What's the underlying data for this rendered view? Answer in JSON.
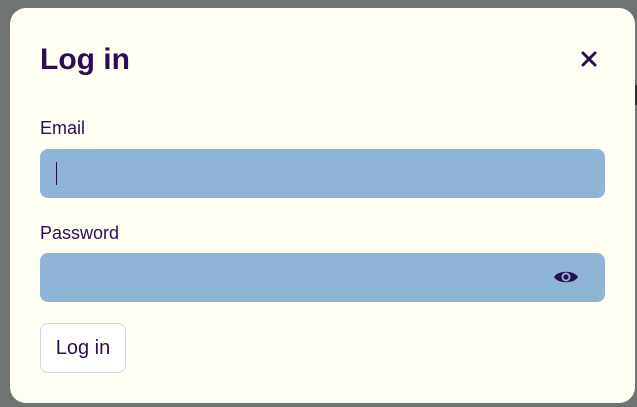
{
  "dialog": {
    "title": "Log in",
    "close_icon": "close-icon",
    "email": {
      "label": "Email",
      "value": "",
      "placeholder": ""
    },
    "password": {
      "label": "Password",
      "value": "",
      "placeholder": "",
      "toggle_icon": "eye-icon"
    },
    "submit_label": "Log in"
  },
  "colors": {
    "backdrop": "#6f7472",
    "dialog_background": "#fefef3",
    "text": "#2d0d52",
    "input_background": "#8fb5d6",
    "button_background": "#ffffff",
    "button_border": "#d6d2e0"
  }
}
